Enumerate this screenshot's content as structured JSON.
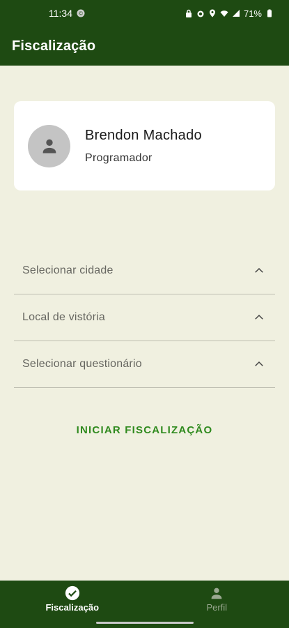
{
  "status_bar": {
    "time": "11:34",
    "battery": "71%"
  },
  "app_bar": {
    "title": "Fiscalização"
  },
  "profile": {
    "name": "Brendon Machado",
    "role": "Programador",
    "avatar_icon": "person-icon"
  },
  "selects": [
    {
      "label": "Selecionar cidade",
      "icon": "chevron-up-icon"
    },
    {
      "label": "Local de vistória",
      "icon": "chevron-up-icon"
    },
    {
      "label": "Selecionar questionário",
      "icon": "chevron-up-icon"
    }
  ],
  "actions": {
    "start_label": "INICIAR FISCALIZAÇÃO"
  },
  "bottom_nav": {
    "items": [
      {
        "label": "Fiscalização",
        "icon": "check-circle-icon",
        "active": true
      },
      {
        "label": "Perfil",
        "icon": "person-icon",
        "active": false
      }
    ]
  },
  "colors": {
    "primary": "#1e4a12",
    "background": "#f0f0e0",
    "accent": "#2f8a1e"
  }
}
